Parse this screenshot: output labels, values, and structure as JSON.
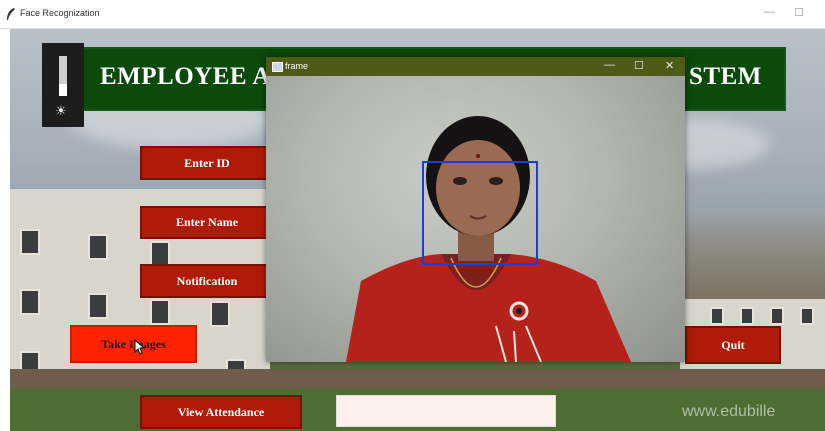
{
  "window": {
    "title": "Face Recognization",
    "minimize_icon": "minimize-icon",
    "maximize_icon": "maximize-icon"
  },
  "banner": {
    "left_text": "EMPLOYEE A",
    "right_text": "STEM"
  },
  "brightness": {
    "level": 0.3,
    "icon": "sun-icon"
  },
  "buttons": {
    "enter_id": "Enter ID",
    "enter_name": "Enter Name",
    "notification": "Notification",
    "take_images": "Take Images",
    "quit": "Quit",
    "view_attendance": "View Attendance"
  },
  "input": {
    "value": ""
  },
  "watermark": "www.edubille",
  "frame_window": {
    "title": "frame"
  },
  "colors": {
    "banner": "#0b4a0b",
    "button": "#b01a08",
    "active_button": "#ff2200",
    "face_box": "#1b3fd6"
  }
}
